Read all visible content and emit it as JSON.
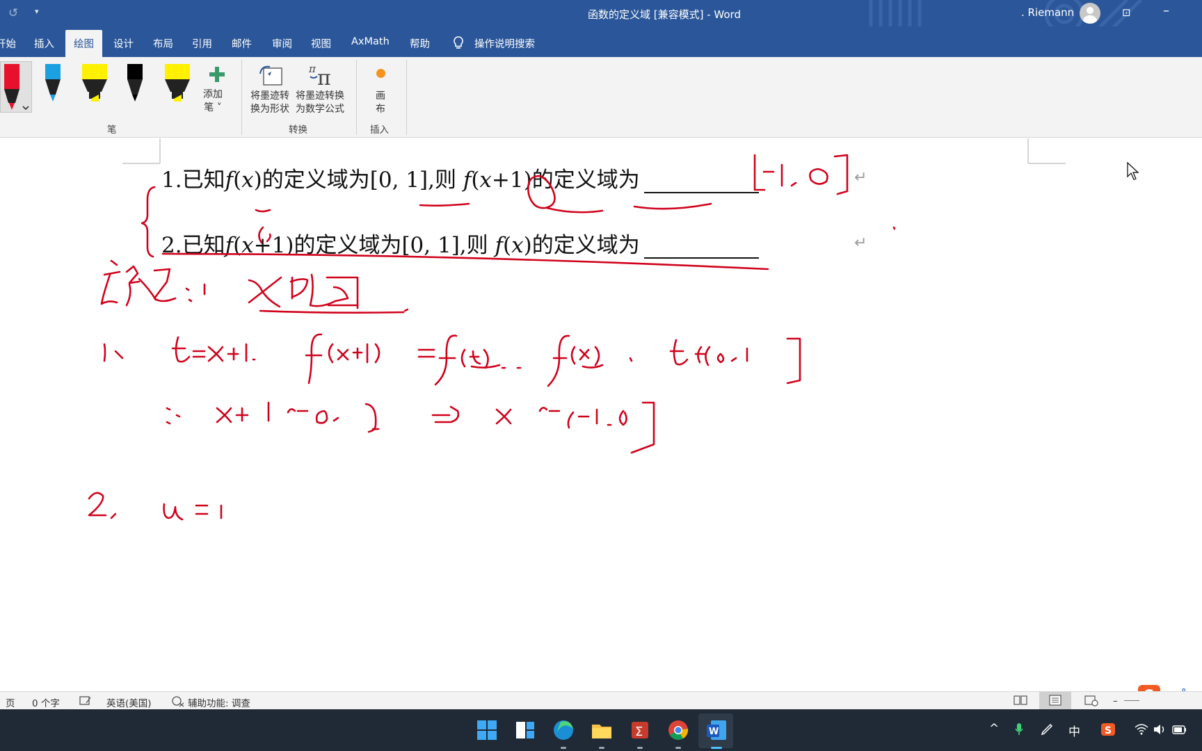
{
  "titlebar": {
    "title": "函数的定义域 [兼容模式]  -  Word",
    "user": ". Riemann",
    "undo_icon": "undo-icon",
    "minimize_label": "–"
  },
  "tabs": [
    {
      "label": "开始"
    },
    {
      "label": "插入"
    },
    {
      "label": "绘图",
      "active": true
    },
    {
      "label": "设计"
    },
    {
      "label": "布局"
    },
    {
      "label": "引用"
    },
    {
      "label": "邮件"
    },
    {
      "label": "审阅"
    },
    {
      "label": "视图"
    },
    {
      "label": "AxMath"
    },
    {
      "label": "帮助"
    },
    {
      "label": "操作说明搜索"
    }
  ],
  "ribbon": {
    "pens": [
      {
        "name": "red-pen",
        "color": "#e8112d"
      },
      {
        "name": "blue-pen",
        "color": "#1ba1e2"
      },
      {
        "name": "yellow-highlighter",
        "color": "#fff100"
      },
      {
        "name": "black-pen",
        "color": "#000000"
      },
      {
        "name": "yellow-highlighter-2",
        "color": "#fff100"
      }
    ],
    "add_pen": "添加\n笔 ˅",
    "add_pen_line1": "添加",
    "add_pen_line2": "笔 ˅",
    "ink_to_shape_line1": "将墨迹转",
    "ink_to_shape_line2": "换为形状",
    "ink_to_math_line1": "将墨迹转换",
    "ink_to_math_line2": "为数学公式",
    "canvas_line1": "画",
    "canvas_line2": "布",
    "groups": {
      "pens": "笔",
      "convert": "转换",
      "insert": "插入"
    }
  },
  "document": {
    "q1": {
      "num": "1.",
      "t1": "已知",
      "t2": "的定义域为",
      "t3": "[0, 1],则",
      "t4": "的定义域为"
    },
    "q2": {
      "num": "2.",
      "t1": "已知",
      "t2": "的定义域为",
      "t3": "[0, 1],则",
      "t4": "的定义域为"
    },
    "para_mark": "↵"
  },
  "status": {
    "page": "页",
    "words": "0 个字",
    "language": "英语(美国)",
    "accessibility": "辅助功能: 调查",
    "zoom_minus": "–",
    "ime_zh": "中",
    "ime_punct": "°,"
  },
  "taskbar": {
    "apps": [
      "windows-start",
      "task-view",
      "edge",
      "file-explorer",
      "mathcad-app",
      "chrome",
      "word"
    ],
    "tray": {
      "chevron": "^",
      "ime": "中"
    }
  },
  "colors": {
    "accent": "#2b579a",
    "ink": "#d0021b"
  }
}
